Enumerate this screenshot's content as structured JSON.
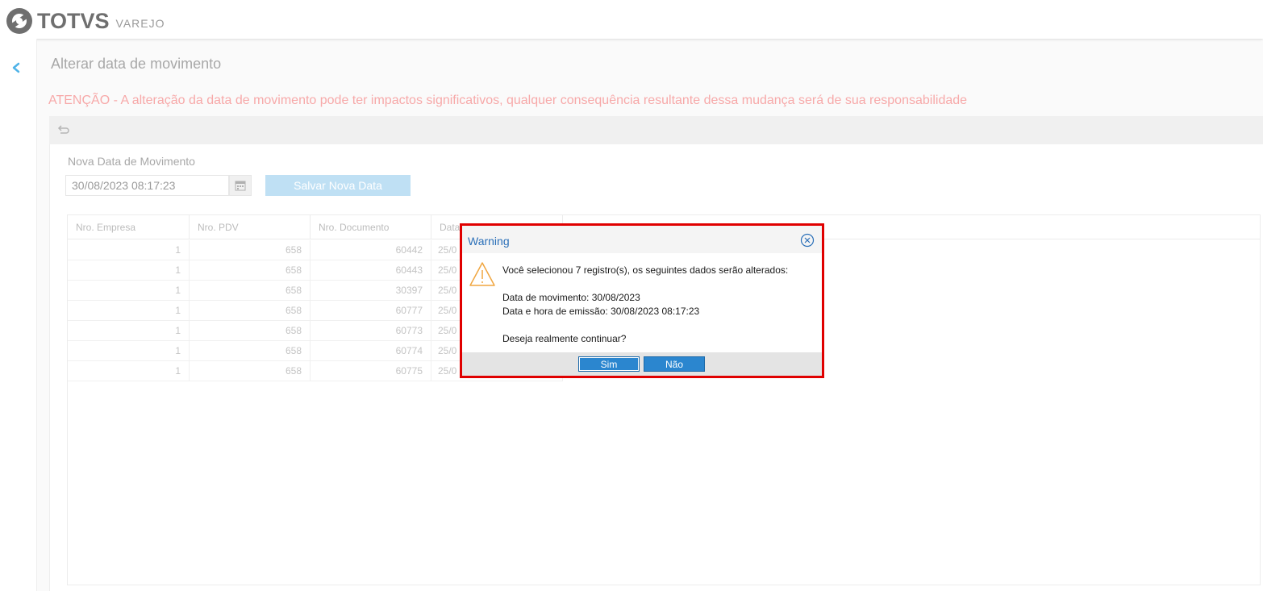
{
  "brand": {
    "name": "TOTVS",
    "sub": "VAREJO"
  },
  "page": {
    "title": "Alterar data de movimento",
    "warning": "ATENÇÃO - A alteração da data de movimento pode ter impactos significativos, qualquer consequência resultante dessa mudança será de sua responsabilidade"
  },
  "form": {
    "date_label": "Nova Data de Movimento",
    "date_value": "30/08/2023 08:17:23",
    "save_label": "Salvar Nova Data"
  },
  "grid": {
    "columns": [
      "Nro. Empresa",
      "Nro. PDV",
      "Nro. Documento",
      "Data"
    ],
    "rows": [
      [
        "1",
        "658",
        "60442",
        "25/0"
      ],
      [
        "1",
        "658",
        "60443",
        "25/0"
      ],
      [
        "1",
        "658",
        "30397",
        "25/0"
      ],
      [
        "1",
        "658",
        "60777",
        "25/0"
      ],
      [
        "1",
        "658",
        "60773",
        "25/0"
      ],
      [
        "1",
        "658",
        "60774",
        "25/0"
      ],
      [
        "1",
        "658",
        "60775",
        "25/0"
      ]
    ]
  },
  "dialog": {
    "title": "Warning",
    "line1": "Você selecionou 7 registro(s), os seguintes dados serão alterados:",
    "line2": "Data de movimento: 30/08/2023",
    "line3": "Data e hora de emissão: 30/08/2023 08:17:23",
    "line4": "Deseja realmente continuar?",
    "yes_label": "Sim",
    "no_label": "Não"
  },
  "colors": {
    "accent": "#2b86cf",
    "warning_text": "#f7a9a9",
    "highlight_border": "#e00000",
    "save_button": "#bfe0f4"
  },
  "icons": [
    "totvs-logo-icon",
    "back-arrow-icon",
    "undo-icon",
    "calendar-icon",
    "close-circle-icon",
    "warning-triangle-icon"
  ]
}
